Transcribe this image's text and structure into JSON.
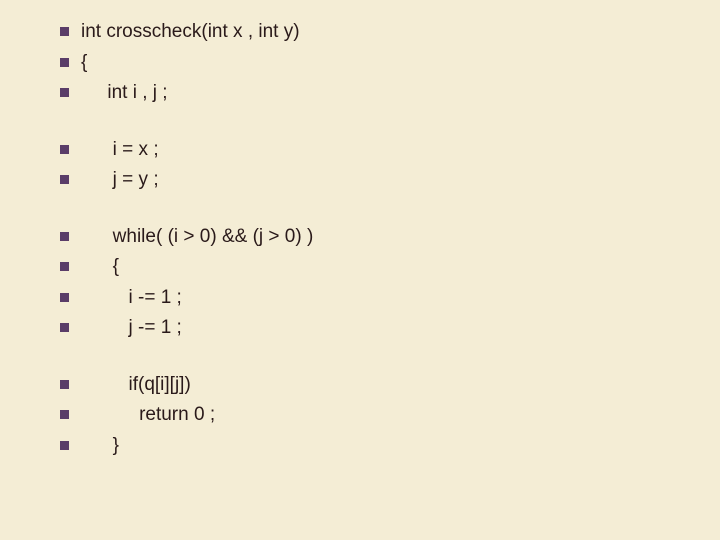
{
  "lines": [
    "int crosscheck(int x , int y)",
    "{",
    "     int i , j ;",
    "",
    "      i = x ;",
    "      j = y ;",
    "",
    "      while( (i > 0) && (j > 0) )",
    "      {",
    "         i -= 1 ;",
    "         j -= 1 ;",
    "",
    "         if(q[i][j])",
    "           return 0 ;",
    "      }"
  ]
}
